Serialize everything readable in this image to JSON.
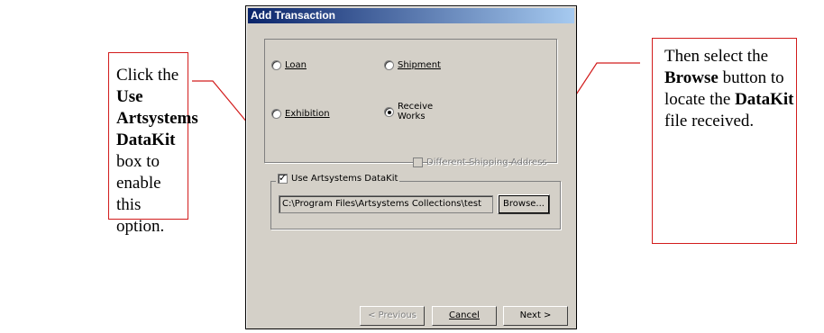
{
  "left_callout": {
    "line1": "Click the ",
    "bold1": "Use Artsystems DataKit",
    "line2": " box to enable this option."
  },
  "right_callout": {
    "line1": "Then select the ",
    "bold1": "Browse",
    "line2": " button to locate the ",
    "bold2": "DataKit",
    "line3": " file received."
  },
  "dialog": {
    "title": "Add Transaction",
    "radios": {
      "loan": {
        "label": "Loan",
        "selected": false
      },
      "shipment": {
        "label": "Shipment",
        "selected": false
      },
      "exhibition": {
        "label": "Exhibition",
        "selected": false
      },
      "receive_line1": "Receive",
      "receive_line2": "Works",
      "receive_selected": true
    },
    "different_shipping": {
      "label": "Different Shipping Address",
      "checked": false
    },
    "datakit": {
      "label": "Use Artsystems DataKit",
      "checked": true
    },
    "path_value": "C:\\Program Files\\Artsystems Collections\\test",
    "browse_label": "Browse...",
    "previous_label": "< Previous",
    "cancel_label": "Cancel",
    "next_label": "Next >"
  },
  "colors": {
    "callout_border": "#d21c1c",
    "dialog_face": "#d4d0c8",
    "titlebar_start": "#0a246a",
    "titlebar_end": "#a6caf0"
  }
}
